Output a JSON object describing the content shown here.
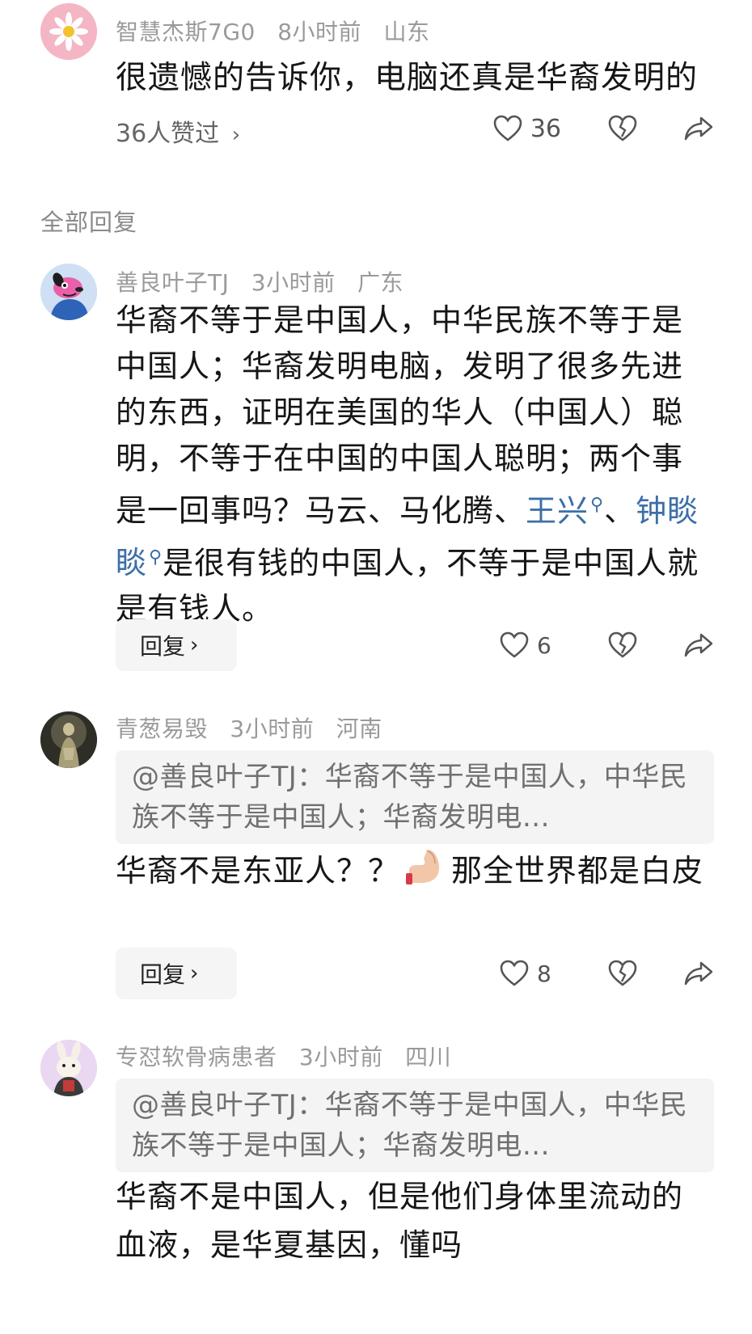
{
  "main_comment": {
    "user": "智慧杰斯7G0",
    "time": "8小时前",
    "location": "山东",
    "text": "很遗憾的告诉你，电脑还真是华裔发明的",
    "likes_link": "36人赞过",
    "like_count": "36"
  },
  "section_label": "全部回复",
  "replies": [
    {
      "user": "善良叶子TJ",
      "time": "3小时前",
      "location": "广东",
      "text_part1": "华裔不等于是中国人，中华民族不等于是中国人；华裔发明电脑，发明了很多先进的东西，证明在美国的华人（中国人）聪明，不等于在中国的中国人聪明；两个事是一回事吗？马云、马化腾、",
      "topic1": "王兴",
      "text_sep": "、",
      "topic2": "钟睒睒",
      "text_part2": "是很有钱的中国人，不等于是中国人就是有钱人。",
      "reply_label": "回复",
      "like_count": "6"
    },
    {
      "user": "青葱易毁",
      "time": "3小时前",
      "location": "河南",
      "quote": "@善良叶子TJ：华裔不等于是中国人，中华民族不等于是中国人；华裔发明电...",
      "text_part1": "华裔不是东亚人？？",
      "text_part2": "那全世界都是白皮",
      "reply_label": "回复",
      "like_count": "8"
    },
    {
      "user": "专怼软骨病患者",
      "time": "3小时前",
      "location": "四川",
      "quote": "@善良叶子TJ：华裔不等于是中国人，中华民族不等于是中国人；华裔发明电...",
      "text": "华裔不是中国人，但是他们身体里流动的血液，是华夏基因，懂吗"
    }
  ],
  "icons": {
    "like": "heart-outline-icon",
    "dislike": "broken-heart-icon",
    "share": "share-arrow-icon",
    "chevron": "chevron-right-icon",
    "search_hint": "magnifier-icon",
    "emoji": "pinched-fingers-emoji"
  }
}
